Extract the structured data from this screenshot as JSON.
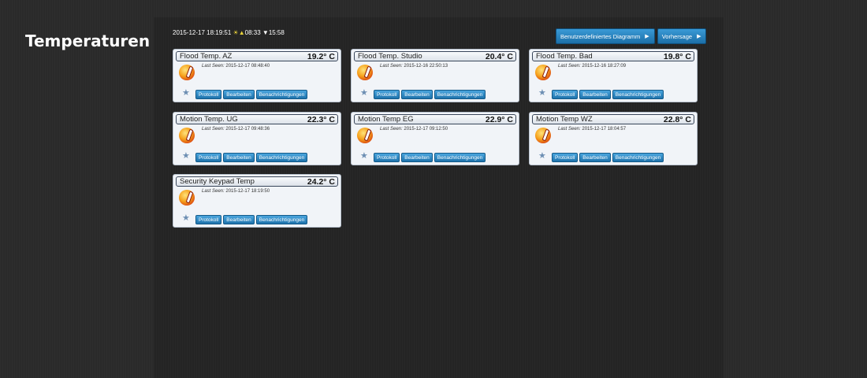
{
  "page": {
    "title": "Temperaturen"
  },
  "status": {
    "datetime": "2015-12-17 18:19:51",
    "sunrise_symbol": "☀▲",
    "sunrise": "08:33",
    "sunset_symbol": "▼",
    "sunset": "15:58"
  },
  "toolbar": {
    "custom_chart_label": "Benutzerdefiniertes Diagramm",
    "forecast_label": "Vorhersage"
  },
  "last_seen_label": "Last Seen:",
  "card_actions": {
    "log_label": "Protokoll",
    "edit_label": "Bearbeiten",
    "notifications_label": "Benachrichtigungen"
  },
  "sensors": [
    {
      "name": "Flood Temp. AZ",
      "temp": "19.2° C",
      "last_seen": "2015-12-17 08:48:40"
    },
    {
      "name": "Flood Temp. Studio",
      "temp": "20.4° C",
      "last_seen": "2015-12-16 22:50:13"
    },
    {
      "name": "Flood Temp. Bad",
      "temp": "19.8° C",
      "last_seen": "2015-12-16 18:27:09"
    },
    {
      "name": "Motion Temp. UG",
      "temp": "22.3° C",
      "last_seen": "2015-12-17 09:48:36"
    },
    {
      "name": "Motion Temp EG",
      "temp": "22.9° C",
      "last_seen": "2015-12-17 09:12:50"
    },
    {
      "name": "Motion Temp WZ",
      "temp": "22.8° C",
      "last_seen": "2015-12-17 18:04:57"
    },
    {
      "name": "Security Keypad Temp",
      "temp": "24.2° C",
      "last_seen": "2015-12-17 18:19:50"
    }
  ]
}
